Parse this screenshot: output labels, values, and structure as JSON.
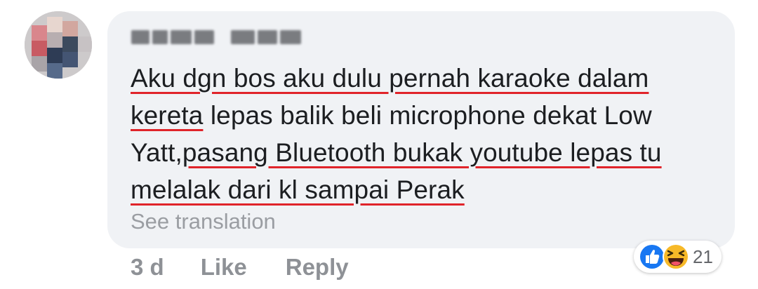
{
  "comment": {
    "author": "Redacted name",
    "text_segments": [
      {
        "text": "Aku dgn bos aku dulu pernah karaoke dalam ",
        "underlined": true
      },
      {
        "text": "kereta",
        "underlined": true
      },
      {
        "text": " lepas balik beli microphone dekat Low Yatt,",
        "underlined": false
      },
      {
        "text": "pasang Bluetooth bukak youtube lepas tu melalak dari kl sampai Perak",
        "underlined": true
      }
    ],
    "see_translation": "See translation",
    "time": "3 d",
    "like_label": "Like",
    "reply_label": "Reply",
    "reactions": {
      "icons": [
        "like-icon",
        "haha-icon"
      ],
      "count": "21"
    }
  },
  "colors": {
    "bubble": "#f0f2f5",
    "text": "#1c1e21",
    "underline": "#e0242a",
    "muted": "#8e9196",
    "like_blue": "#1877f2",
    "haha_yellow": "#f7b928"
  }
}
